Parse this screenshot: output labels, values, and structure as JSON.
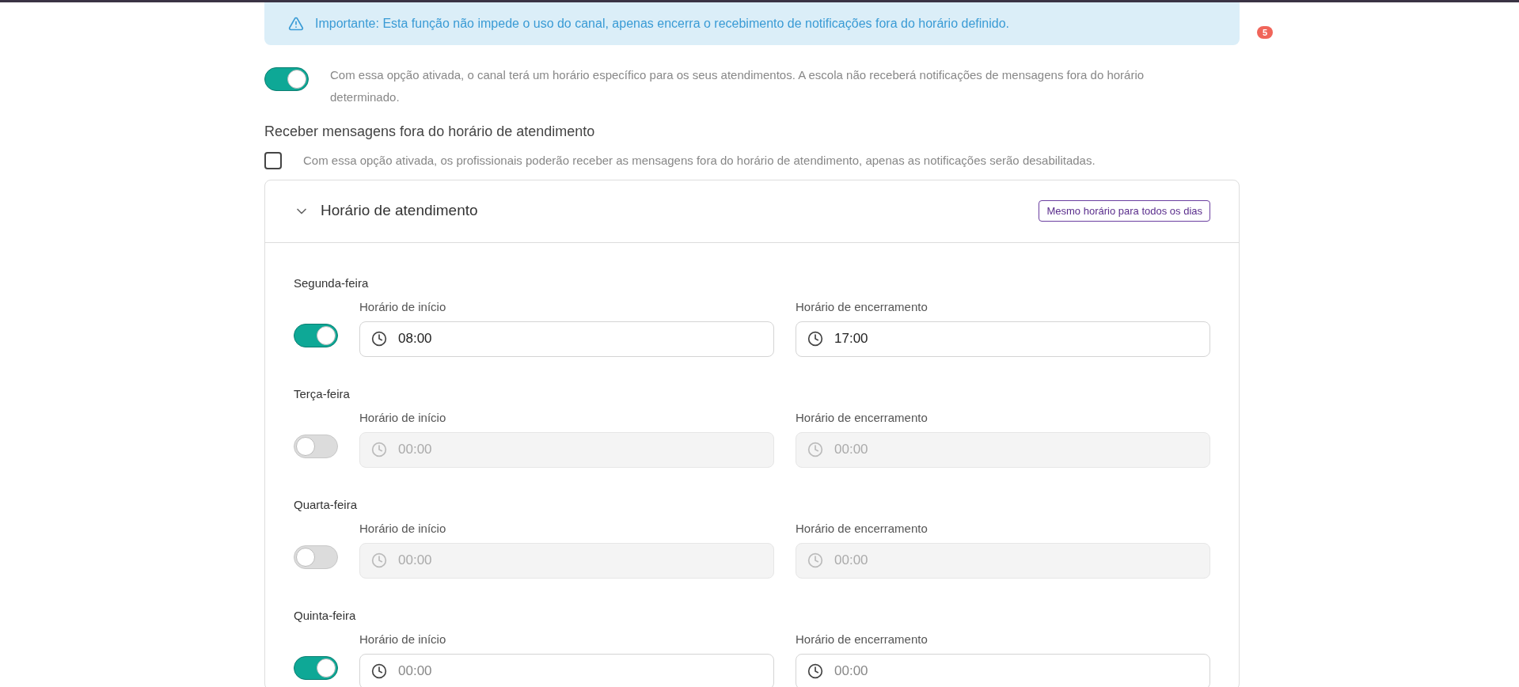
{
  "alert": {
    "text": "Importante: Esta função não impede o uso do canal, apenas encerra o recebimento de notificações fora do horário definido."
  },
  "badge": "5",
  "schedule_toggle": {
    "on": true,
    "description": "Com essa opção ativada, o canal terá um horário específico para os seus atendimentos. A escola não receberá notificações de mensagens fora do horário determinado."
  },
  "outside_hours": {
    "heading": "Receber mensagens fora do horário de atendimento",
    "checked": false,
    "description": "Com essa opção ativada, os profissionais poderão receber as mensagens fora do horário de atendimento, apenas as notificações serão desabilitadas."
  },
  "panel": {
    "title": "Horário de atendimento",
    "expanded": true,
    "same_hours_button": "Mesmo horário para todos os dias",
    "days": [
      {
        "name": "Segunda-feira",
        "on": true,
        "start": {
          "label": "Horário de início",
          "value": "08:00"
        },
        "end": {
          "label": "Horário de encerramento",
          "value": "17:00"
        }
      },
      {
        "name": "Terça-feira",
        "on": false,
        "start": {
          "label": "Horário de início",
          "placeholder": "00:00"
        },
        "end": {
          "label": "Horário de encerramento",
          "placeholder": "00:00"
        }
      },
      {
        "name": "Quarta-feira",
        "on": false,
        "start": {
          "label": "Horário de início",
          "placeholder": "00:00"
        },
        "end": {
          "label": "Horário de encerramento",
          "placeholder": "00:00"
        }
      },
      {
        "name": "Quinta-feira",
        "on": true,
        "start": {
          "label": "Horário de início",
          "placeholder": "00:00"
        },
        "end": {
          "label": "Horário de encerramento",
          "placeholder": "00:00"
        }
      }
    ]
  }
}
